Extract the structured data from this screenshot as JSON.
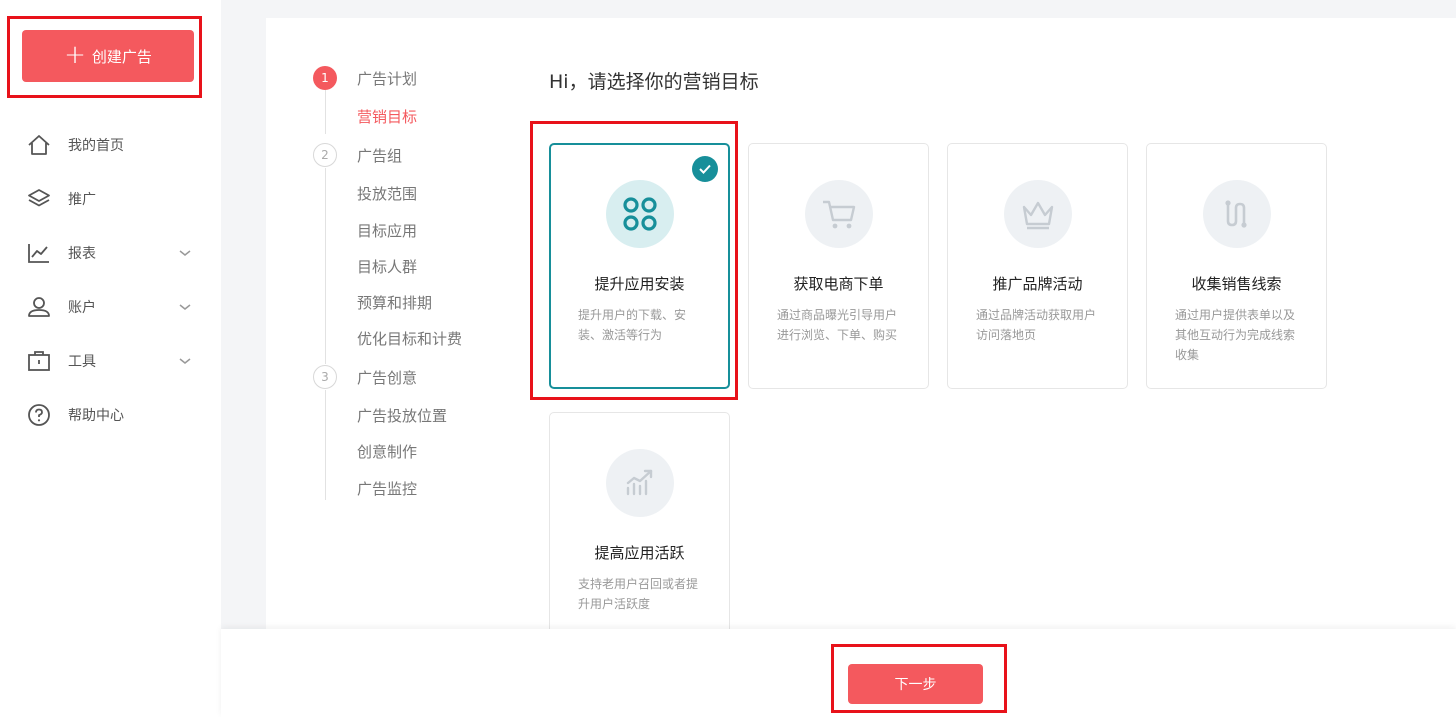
{
  "sidebar": {
    "create_label": "创建广告",
    "items": [
      {
        "label": "我的首页",
        "icon": "home-icon"
      },
      {
        "label": "推广",
        "icon": "layers-icon"
      },
      {
        "label": "报表",
        "icon": "chart-icon"
      },
      {
        "label": "账户",
        "icon": "user-icon"
      },
      {
        "label": "工具",
        "icon": "toolbox-icon"
      },
      {
        "label": "帮助中心",
        "icon": "help-icon"
      }
    ]
  },
  "steps": {
    "step1": {
      "num": "1",
      "label": "广告计划",
      "sub": [
        "营销目标"
      ]
    },
    "step2": {
      "num": "2",
      "label": "广告组",
      "sub": [
        "投放范围",
        "目标应用",
        "目标人群",
        "预算和排期",
        "优化目标和计费"
      ]
    },
    "step3": {
      "num": "3",
      "label": "广告创意",
      "sub": [
        "广告投放位置",
        "创意制作",
        "广告监控"
      ]
    }
  },
  "heading": "Hi，请选择你的营销目标",
  "cards": [
    {
      "title": "提升应用安装",
      "desc": "提升用户的下载、安装、激活等行为",
      "icon": "app-grid-icon",
      "selected": true
    },
    {
      "title": "获取电商下单",
      "desc": "通过商品曝光引导用户进行浏览、下单、购买",
      "icon": "cart-icon",
      "selected": false
    },
    {
      "title": "推广品牌活动",
      "desc": "通过品牌活动获取用户访问落地页",
      "icon": "crown-icon",
      "selected": false
    },
    {
      "title": "收集销售线索",
      "desc": "通过用户提供表单以及其他互动行为完成线索收集",
      "icon": "route-icon",
      "selected": false
    },
    {
      "title": "提高应用活跃",
      "desc": "支持老用户召回或者提升用户活跃度",
      "icon": "growth-chart-icon",
      "selected": false
    }
  ],
  "footer": {
    "next_label": "下一步"
  },
  "colors": {
    "accent": "#f4595e",
    "selected": "#178f9a",
    "annotation": "#e8121a"
  }
}
